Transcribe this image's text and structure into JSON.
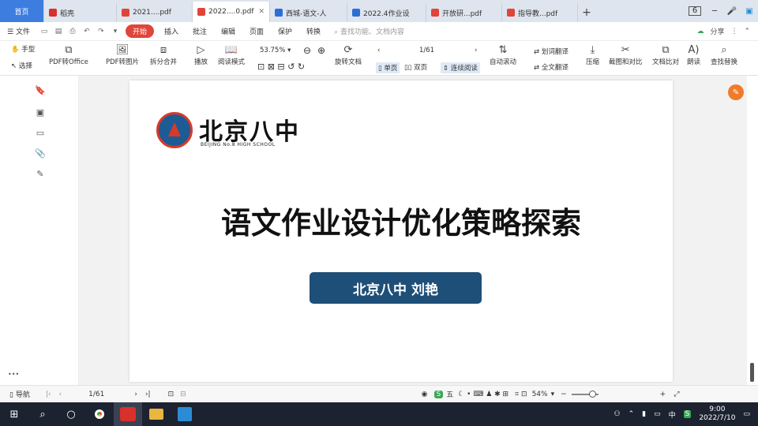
{
  "tabs": [
    {
      "label": "首页",
      "type": "home"
    },
    {
      "label": "稻壳",
      "icon": "docer-icon"
    },
    {
      "label": "2021....pdf",
      "icon": "pdf-icon"
    },
    {
      "label": "2022....0.pdf",
      "icon": "pdf-icon",
      "active": true
    },
    {
      "label": "西城-语文-人",
      "icon": "writer-icon"
    },
    {
      "label": "2022.4作业设",
      "icon": "writer-icon"
    },
    {
      "label": "开放研...pdf",
      "icon": "pdf-icon"
    },
    {
      "label": "指导教...pdf",
      "icon": "pdf-icon"
    }
  ],
  "window": {
    "badge": "6"
  },
  "menu": {
    "file": "文件",
    "items": [
      "开始",
      "插入",
      "批注",
      "编辑",
      "页面",
      "保护",
      "转换"
    ],
    "search_placeholder": "查找功能、文档内容",
    "share": "分享"
  },
  "toolbar": {
    "hand": "手型",
    "select": "选择",
    "pdf_to_office": "PDF转Office",
    "pdf_to_image": "PDF转图片",
    "split_merge": "拆分合并",
    "play": "播放",
    "read_mode": "阅读模式",
    "zoom": "53.75%",
    "page": "1/61",
    "rotate": "旋转文档",
    "single": "单页",
    "double": "双页",
    "continuous": "连续阅读",
    "auto_scroll": "自动滚动",
    "word_translate": "划词翻译",
    "full_translate": "全文翻译",
    "compress": "压缩",
    "screenshot_compare": "截图和对比",
    "doc_compare": "文档比对",
    "read_aloud": "朗读",
    "find_replace": "查找替换"
  },
  "document": {
    "logo_cn": "北京八中",
    "logo_en": "BEIJING No.8 HIGH SCHOOL",
    "title": "语文作业设计优化策略探索",
    "author": "北京八中  刘艳"
  },
  "status": {
    "nav": "导航",
    "page": "1/61",
    "zoom": "54%",
    "five": "五"
  },
  "taskbar": {
    "time": "9:00",
    "date": "2022/7/10",
    "ime": "中"
  }
}
